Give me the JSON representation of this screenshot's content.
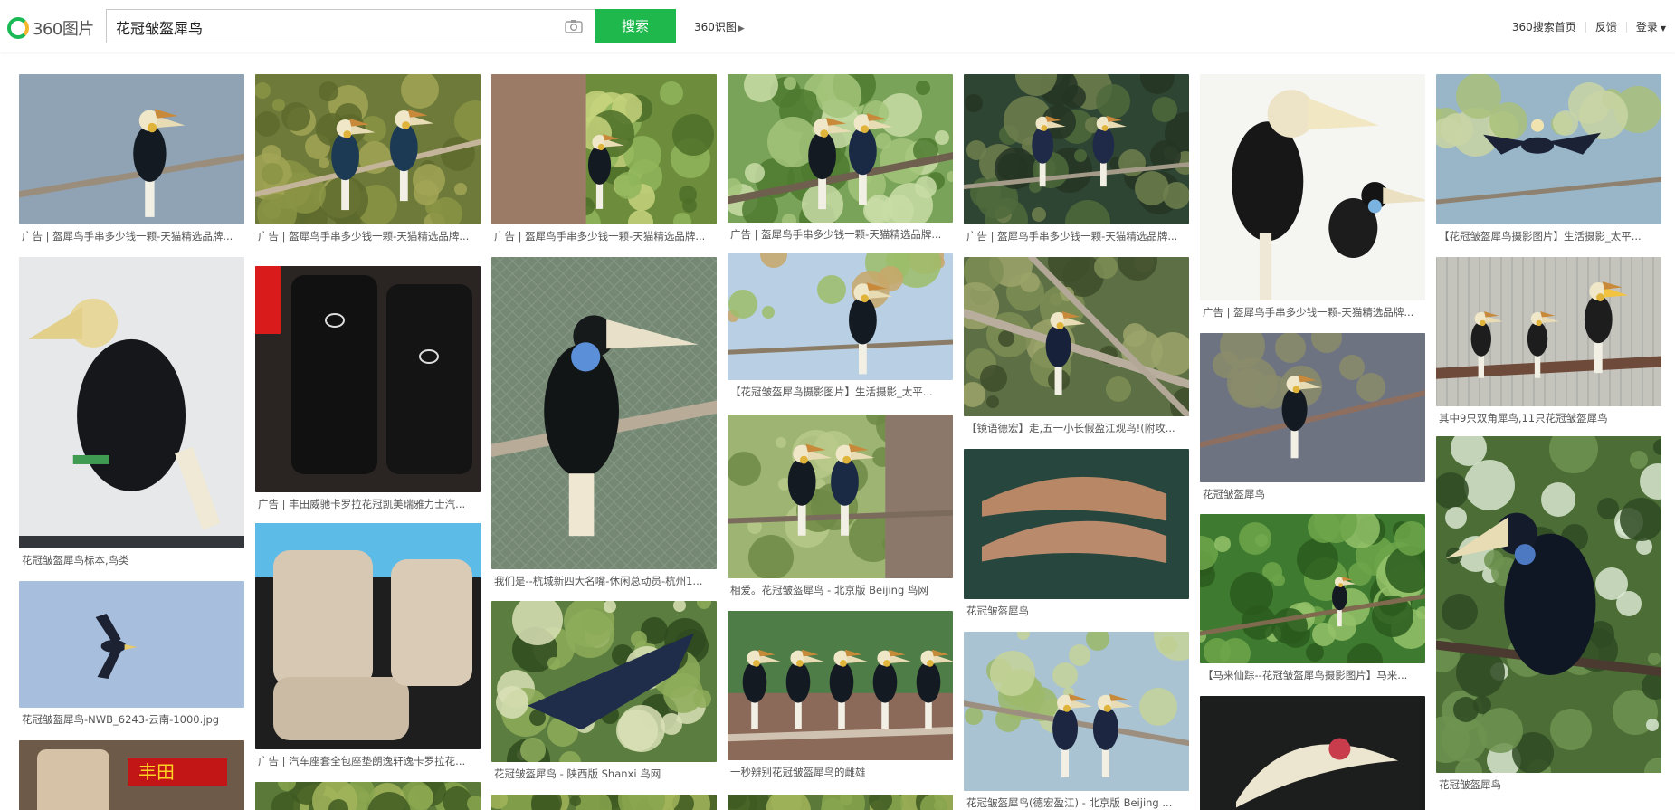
{
  "header": {
    "logo_text": "360图片",
    "search_value": "花冠皱盔犀鸟",
    "search_button": "搜索",
    "shitu_label": "360识图",
    "links": [
      "360搜索首页",
      "反馈",
      "登录"
    ]
  },
  "colors": {
    "accent": "#1fb84c"
  },
  "columns": [
    [
      {
        "caption": "广告 | 盔犀鸟手串多少钱一颗-天猫精选品牌...",
        "scene": "bird_sky"
      },
      {
        "caption": "花冠皱盔犀鸟标本,鸟类",
        "scene": "specimen"
      },
      {
        "caption": "花冠皱盔犀鸟-NWB_6243-云南-1000.jpg",
        "scene": "flying_blue"
      },
      {
        "caption": "",
        "scene": "seat_ad"
      }
    ],
    [
      {
        "caption": "广告 | 盔犀鸟手串多少钱一颗-天猫精选品牌...",
        "scene": "pair_green"
      },
      {
        "caption": "广告 | 丰田威驰卡罗拉花冠凯美瑞雅力士汽...",
        "scene": "toyota_seat"
      },
      {
        "caption": "广告 | 汽车座套全包座垫朗逸轩逸卡罗拉花...",
        "scene": "beige_seat"
      },
      {
        "caption": "",
        "scene": "forest"
      }
    ],
    [
      {
        "caption": "广告 | 盔犀鸟手串多少钱一颗-天猫精选品牌...",
        "scene": "trunk"
      },
      {
        "caption": "我们是--杭城新四大名嘴-休闲总动员-杭州1...",
        "scene": "dark_bird_mesh"
      },
      {
        "caption": "花冠皱盔犀鸟 - 陕西版 Shanxi 鸟网",
        "scene": "flying_green"
      },
      {
        "caption": "",
        "scene": "forest"
      }
    ],
    [
      {
        "caption": "广告 | 盔犀鸟手串多少钱一颗-天猫精选品牌...",
        "scene": "pair_leaves"
      },
      {
        "caption": "【花冠皱盔犀鸟摄影图片】生活摄影_太平...",
        "scene": "bird_blue_sky"
      },
      {
        "caption": "相爱。花冠皱盔犀鸟 - 北京版 Beijing 鸟网",
        "scene": "pair_trunk"
      },
      {
        "caption": "一秒辨别花冠皱盔犀鸟的雌雄",
        "scene": "group"
      },
      {
        "caption": "",
        "scene": "forest"
      }
    ],
    [
      {
        "caption": "广告 | 盔犀鸟手串多少钱一颗-天猫精选品牌...",
        "scene": "pair_dark"
      },
      {
        "caption": "【镜语德宏】走,五一小长假盈江观鸟!(附攻...",
        "scene": "branch_bird"
      },
      {
        "caption": "花冠皱盔犀鸟",
        "scene": "casques"
      },
      {
        "caption": "花冠皱盔犀鸟(德宏盈江) - 北京版 Beijing ...",
        "scene": "pair_blue"
      }
    ],
    [
      {
        "caption": "广告 | 盔犀鸟手串多少钱一颗-天猫精选品牌...",
        "scene": "illustration"
      },
      {
        "caption": "花冠皱盔犀鸟",
        "scene": "bird_evening"
      },
      {
        "caption": "【马来仙踪--花冠皱盔犀鸟摄影图片】马来...",
        "scene": "bird_tree"
      },
      {
        "caption": "",
        "scene": "bill_close"
      }
    ],
    [
      {
        "caption": "【花冠皱盔犀鸟摄影图片】生活摄影_太平...",
        "scene": "flying_branch"
      },
      {
        "caption": "其中9只双角犀鸟,11只花冠皱盔犀鸟",
        "scene": "zoo"
      },
      {
        "caption": "花冠皱盔犀鸟",
        "scene": "tall_bird"
      }
    ]
  ]
}
